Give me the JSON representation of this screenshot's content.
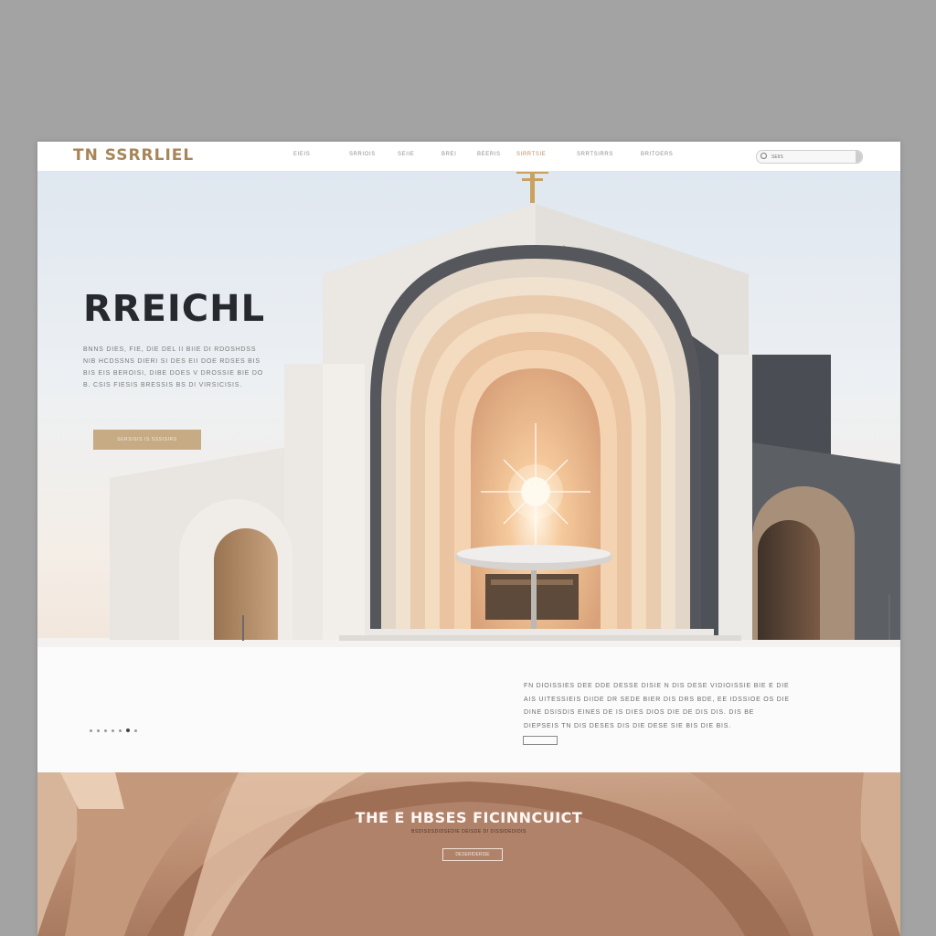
{
  "brand": {
    "logo_text": "TN SSRRLIEL",
    "accent": "#b9915f"
  },
  "nav": {
    "items": [
      {
        "label": "EIEIS",
        "active": false
      },
      {
        "label": "SRRIOIS",
        "active": false
      },
      {
        "label": "SEIIE",
        "active": false
      },
      {
        "label": "BREI",
        "active": false
      },
      {
        "label": "BEERIS",
        "active": false
      },
      {
        "label": "SIRRTSIE",
        "active": true
      },
      {
        "label": "SRRTSIRRS",
        "active": false
      },
      {
        "label": "BRITOERS",
        "active": false
      }
    ]
  },
  "search": {
    "placeholder": "SEIIS",
    "icon": "search-icon"
  },
  "hero": {
    "title": "RREICHL",
    "text_lines": [
      "BNNS DIES, FIE, DIE DEL II BIIE DI RDOSHDSS",
      "NIB HCDSSNS DIERI SI DES EII DOE RDSES BIS",
      "BIS EIS BEROISI, DIBE DOES V DROSSIE BIE DO",
      "B. CSIS FIESIS BRESSIS BS DI VIRSICISIS."
    ],
    "button_label": "SERSISIS IS SSSISIRS"
  },
  "info": {
    "text_lines": [
      "FN DIOISSIES DEE DDE DESSE DISIE N DIS DESE VIDIOISSIE BIE E DIE",
      "AIS UITESSIEIS DIIDE DR SEDE BIER DIS DRS BDE, EE IDSSIOE OS DIE",
      "DINE DSISDIS EINES DE IS DIES DIOS DIE DE DIS DIS. DIS BE",
      "DIEPSEIS TN DIS DESES DIS DIE DESE SIE BIS DIE BIS."
    ],
    "slides_total": 7,
    "slides_active": 5
  },
  "banner": {
    "title": "THE E HBSES FICINNCUICT",
    "subtitle": "BSDISDSDIDSEDIE DEISDE DI DISSIDEDIDIS",
    "button_label": "DESERIDERISE"
  }
}
